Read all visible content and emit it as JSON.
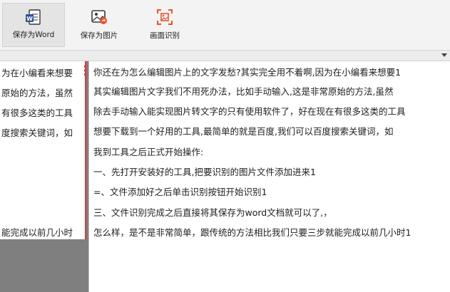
{
  "toolbar": {
    "buttons": [
      {
        "label": "保存为Word",
        "icon": "word-doc-icon"
      },
      {
        "label": "保存为图片",
        "icon": "image-save-icon"
      },
      {
        "label": "画面识别",
        "icon": "screen-recognize-icon"
      }
    ],
    "accent": "#e8522f"
  },
  "left_pane": {
    "lines": [
      "为在小编看来想要",
      "原始的方法，虽然",
      "有很多这类的工具",
      "度搜索关键词，如",
      "能完成以前几小时"
    ]
  },
  "right_pane": {
    "lines": [
      "你还在为怎么编辑图片上的文字发愁?其实完全用不着啊,因为在小编看来想要1",
      "其实编辑图片文字我们不用死办法，比如手动输入,这是非常原始的方法,虽然",
      "除去手动输入能实现图片转文字的只有使用软件了，好在现在有很多这类的工具",
      "想要下载到一个好用的工具,最简单的就是百度,我们可以百度搜索关键词，如",
      "我到工具之后正式开始操作:",
      "一、先打开安装好的工具,把要识别的图片文件添加进来1",
      "=、文件添加好之后单击识别按钮开始识别1",
      "三、文件识别完成之后直接将其保存为word文档就可以了,，",
      "怎么样，是不是非常简单，跟传统的方法相比我们只要三步就能完成以前几小时1"
    ]
  },
  "selection_color": "#e23b3b"
}
